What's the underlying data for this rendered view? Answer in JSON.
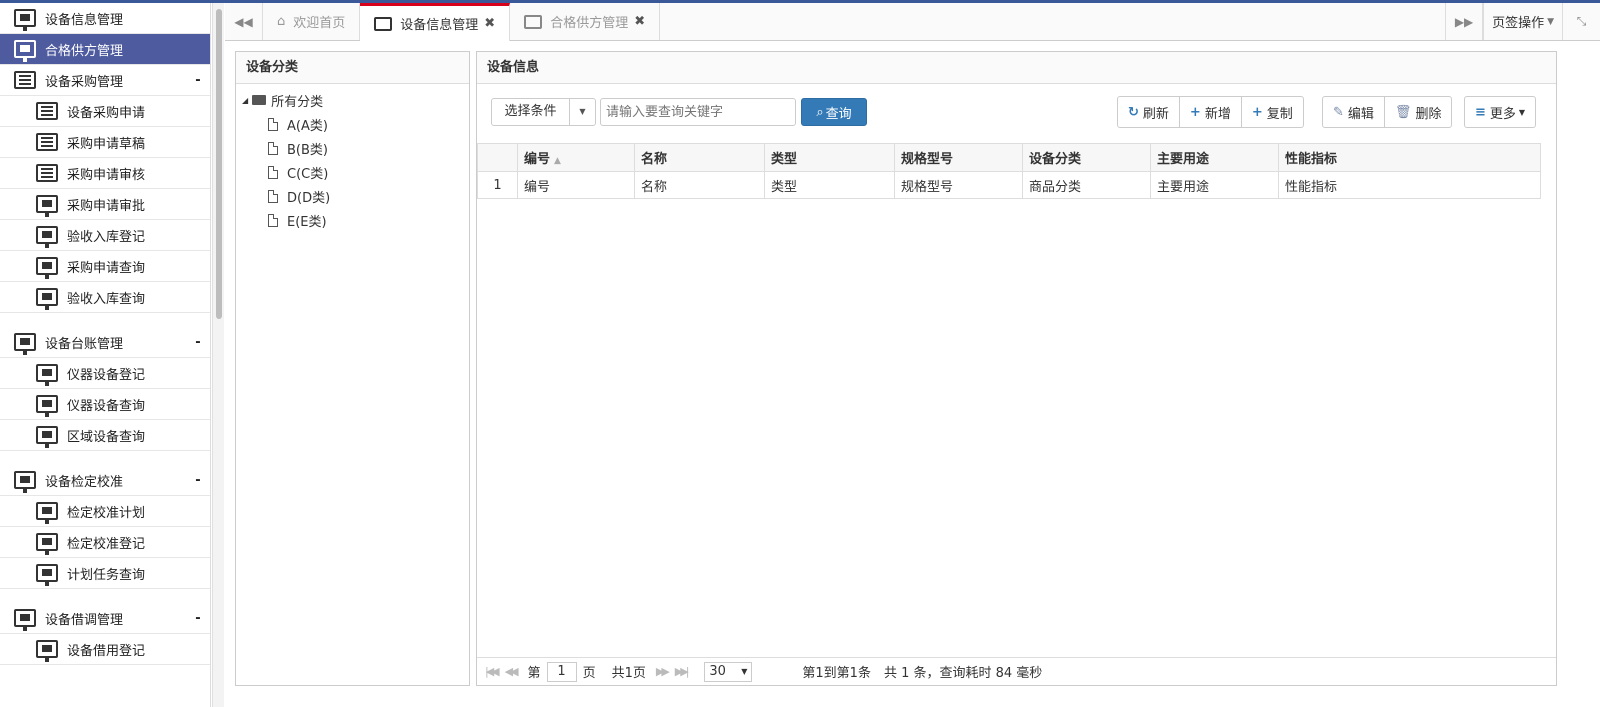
{
  "sidebar": {
    "items": [
      {
        "label": "设备信息管理",
        "level": "top",
        "icon": "monitor-icon",
        "active": false
      },
      {
        "label": "合格供方管理",
        "level": "top",
        "icon": "monitor-icon",
        "active": true
      },
      {
        "label": "设备采购管理",
        "level": "top",
        "icon": "list-icon",
        "collapse": "-"
      },
      {
        "label": "设备采购申请",
        "level": "sub",
        "icon": "list-icon"
      },
      {
        "label": "采购申请草稿",
        "level": "sub",
        "icon": "list-icon"
      },
      {
        "label": "采购申请审核",
        "level": "sub",
        "icon": "list-icon"
      },
      {
        "label": "采购申请审批",
        "level": "sub",
        "icon": "monitor-icon"
      },
      {
        "label": "验收入库登记",
        "level": "sub",
        "icon": "monitor-icon"
      },
      {
        "label": "采购申请查询",
        "level": "sub",
        "icon": "monitor-icon"
      },
      {
        "label": "验收入库查询",
        "level": "sub",
        "icon": "monitor-icon"
      },
      {
        "label": "设备台账管理",
        "level": "top",
        "icon": "monitor-icon",
        "collapse": "-",
        "gap": true
      },
      {
        "label": "仪器设备登记",
        "level": "sub",
        "icon": "monitor-icon"
      },
      {
        "label": "仪器设备查询",
        "level": "sub",
        "icon": "monitor-icon"
      },
      {
        "label": "区域设备查询",
        "level": "sub",
        "icon": "monitor-icon"
      },
      {
        "label": "设备检定校准",
        "level": "top",
        "icon": "monitor-icon",
        "collapse": "-",
        "gap": true
      },
      {
        "label": "检定校准计划",
        "level": "sub",
        "icon": "monitor-icon"
      },
      {
        "label": "检定校准登记",
        "level": "sub",
        "icon": "monitor-icon"
      },
      {
        "label": "计划任务查询",
        "level": "sub",
        "icon": "monitor-icon"
      },
      {
        "label": "设备借调管理",
        "level": "top",
        "icon": "monitor-icon",
        "collapse": "-",
        "gap": true
      },
      {
        "label": "设备借用登记",
        "level": "sub",
        "icon": "monitor-icon"
      }
    ]
  },
  "tabbar": {
    "home_label": "欢迎首页",
    "tabs": [
      {
        "label": "设备信息管理",
        "close": "✖",
        "active": true
      },
      {
        "label": "合格供方管理",
        "close": "✖",
        "active": false
      }
    ],
    "ops_label": "页签操作"
  },
  "category": {
    "title": "设备分类",
    "root": "所有分类",
    "nodes": [
      "A(A类)",
      "B(B类)",
      "C(C类)",
      "D(D类)",
      "E(E类)"
    ]
  },
  "info": {
    "title": "设备信息",
    "select_label": "选择条件",
    "search_placeholder": "请输入要查询关键字",
    "search_button": "查询",
    "refresh": "刷新",
    "add": "新增",
    "copy": "复制",
    "edit": "编辑",
    "delete": "删除",
    "more": "更多"
  },
  "table": {
    "columns": [
      "编号",
      "名称",
      "类型",
      "规格型号",
      "设备分类",
      "主要用途",
      "性能指标"
    ],
    "rows": [
      {
        "rn": "1",
        "cells": [
          "编号",
          "名称",
          "类型",
          "规格型号",
          "商品分类",
          "主要用途",
          "性能指标"
        ]
      }
    ]
  },
  "pager": {
    "page_prefix": "第",
    "page_value": "1",
    "page_suffix": "页",
    "total_pages": "共1页",
    "page_size": "30",
    "info": "第1到第1条　共 1 条，查询耗时 84 毫秒"
  }
}
